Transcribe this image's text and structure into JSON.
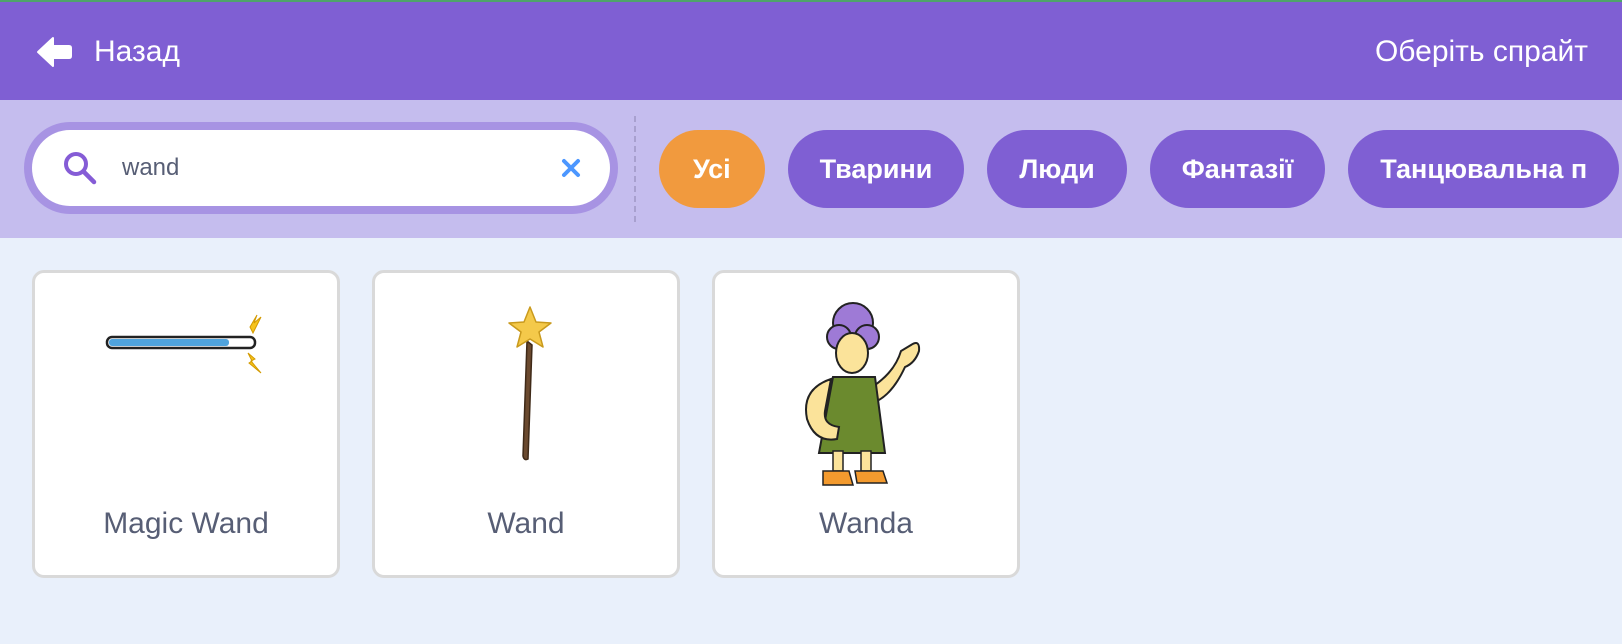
{
  "header": {
    "back_label": "Назад",
    "title": "Оберіть спрайт"
  },
  "search": {
    "value": "wand",
    "placeholder": ""
  },
  "tags": [
    {
      "label": "Усі",
      "active": true
    },
    {
      "label": "Тварини",
      "active": false
    },
    {
      "label": "Люди",
      "active": false
    },
    {
      "label": "Фантазії",
      "active": false
    },
    {
      "label": "Танцювальна п",
      "active": false
    }
  ],
  "sprites": [
    {
      "name": "Magic Wand",
      "icon": "magic-wand-sprite"
    },
    {
      "name": "Wand",
      "icon": "star-wand-sprite"
    },
    {
      "name": "Wanda",
      "icon": "wanda-character-sprite"
    }
  ],
  "colors": {
    "header_bg": "#7f5fd3",
    "filter_bg": "#c5bdee",
    "tag_bg": "#7f5fd3",
    "tag_active_bg": "#f19a3e",
    "page_bg": "#e9f0fb",
    "text": "#575e75"
  }
}
